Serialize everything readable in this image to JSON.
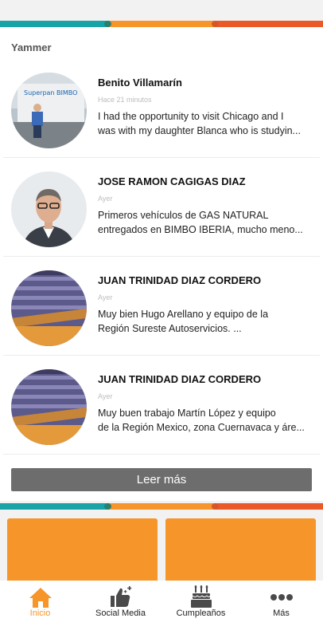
{
  "colors": {
    "teal": "#18a3a7",
    "orange": "#f6962a",
    "red_orange": "#ea5a29",
    "button_gray": "#6d6d6d",
    "active_tab": "#f6962a"
  },
  "section": {
    "title": "Yammer"
  },
  "posts": [
    {
      "author": "Benito Villamarín",
      "time": "Hace 21 minutos",
      "line1": "I had the opportunity to visit Chicago and I",
      "line2": "was with my daughter Blanca who is studyin...",
      "avatar_text": "Superpan BIMBO",
      "avatar_icon": "truck-photo"
    },
    {
      "author": "JOSE RAMON CAGIGAS DIAZ",
      "time": "Ayer",
      "line1": "Primeros vehículos de GAS NATURAL",
      "line2": "entregados en BIMBO IBERIA, mucho meno...",
      "avatar_icon": "portrait-photo"
    },
    {
      "author": "JUAN TRINIDAD DIAZ CORDERO",
      "time": "Ayer",
      "line1": "Muy bien Hugo Arellano y equipo de la",
      "line2": "Región Sureste Autoservicios. ...",
      "avatar_icon": "stadium-photo"
    },
    {
      "author": "JUAN TRINIDAD DIAZ CORDERO",
      "time": "Ayer",
      "line1": "Muy buen trabajo Martín López y equipo",
      "line2": "de la Región Mexico, zona Cuernavaca y áre...",
      "avatar_icon": "stadium-photo"
    }
  ],
  "read_more": "Leer más",
  "nav": {
    "items": [
      {
        "label": "Inicio",
        "icon": "home-icon",
        "active": true
      },
      {
        "label": "Social Media",
        "icon": "thumbs-up-icon",
        "active": false
      },
      {
        "label": "Cumpleaños",
        "icon": "birthday-cake-icon",
        "active": false
      },
      {
        "label": "Más",
        "icon": "more-dots-icon",
        "active": false
      }
    ]
  }
}
